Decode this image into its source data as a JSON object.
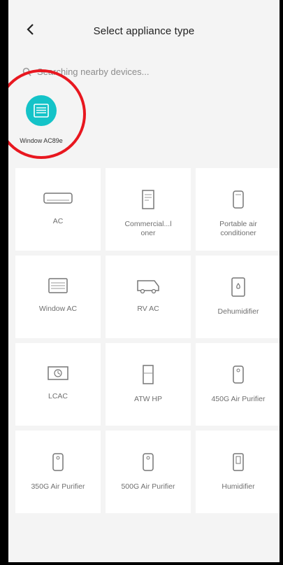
{
  "header": {
    "title": "Select appliance type"
  },
  "search": {
    "status": "Searching nearby devices..."
  },
  "found_device": {
    "name": "Window AC89e"
  },
  "tiles": [
    {
      "label": "AC"
    },
    {
      "label": "Commercial...l oner"
    },
    {
      "label": "Portable air conditioner"
    },
    {
      "label": "Window AC"
    },
    {
      "label": "RV AC"
    },
    {
      "label": "Dehumidifier"
    },
    {
      "label": "LCAC"
    },
    {
      "label": "ATW HP"
    },
    {
      "label": "450G Air Purifier"
    },
    {
      "label": "350G Air Purifier"
    },
    {
      "label": "500G Air Purifier"
    },
    {
      "label": "Humidifier"
    }
  ],
  "colors": {
    "accent": "#14c3c8",
    "highlight_ring": "#e8171f"
  }
}
